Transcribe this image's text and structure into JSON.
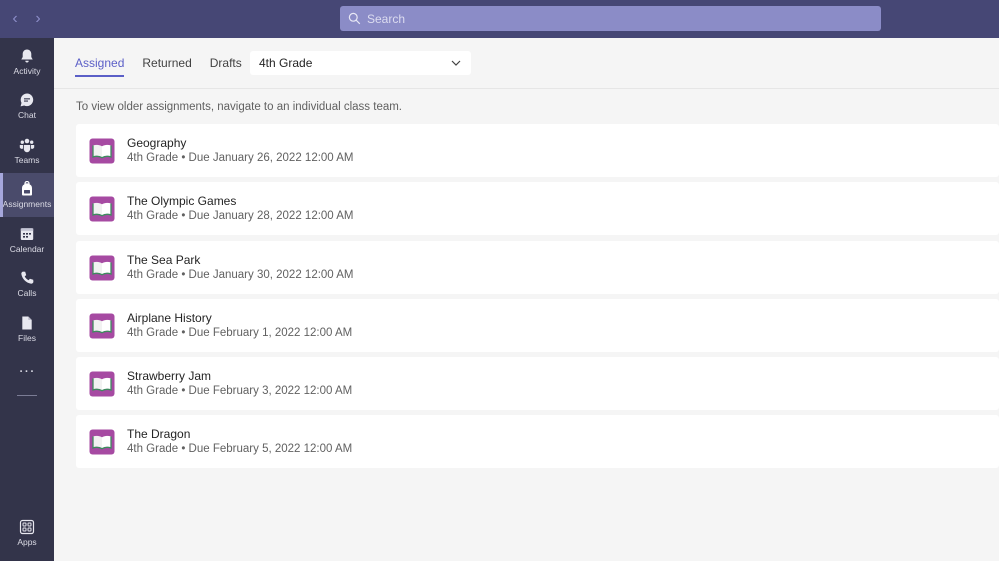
{
  "topbar": {
    "back_icon": "chevron-left-icon",
    "forward_icon": "chevron-right-icon",
    "search_placeholder": "Search",
    "colors": {
      "bar": "#464775",
      "search_bg": "#8b8cc7"
    }
  },
  "rail": {
    "items": [
      {
        "id": "activity",
        "label": "Activity",
        "icon": "bell-icon"
      },
      {
        "id": "chat",
        "label": "Chat",
        "icon": "chat-icon"
      },
      {
        "id": "teams",
        "label": "Teams",
        "icon": "teams-icon"
      },
      {
        "id": "assignments",
        "label": "Assignments",
        "icon": "backpack-icon",
        "active": true
      },
      {
        "id": "calendar",
        "label": "Calendar",
        "icon": "calendar-icon"
      },
      {
        "id": "calls",
        "label": "Calls",
        "icon": "phone-icon"
      },
      {
        "id": "files",
        "label": "Files",
        "icon": "file-icon"
      }
    ],
    "more": "...",
    "apps_label": "Apps"
  },
  "main": {
    "tabs": [
      {
        "label": "Assigned",
        "active": true
      },
      {
        "label": "Returned"
      },
      {
        "label": "Drafts"
      }
    ],
    "class_filter": "4th Grade",
    "hint": "To view older assignments, navigate to an individual class team.",
    "accent": "#5b5fc7",
    "assignments": [
      {
        "title": "Geography",
        "meta": "4th Grade • Due January 26, 2022 12:00 AM"
      },
      {
        "title": "The Olympic Games",
        "meta": "4th Grade • Due January 28, 2022 12:00 AM"
      },
      {
        "title": "The Sea Park",
        "meta": "4th Grade • Due January 30, 2022 12:00 AM"
      },
      {
        "title": "Airplane History",
        "meta": "4th Grade • Due February 1, 2022 12:00 AM"
      },
      {
        "title": "Strawberry Jam",
        "meta": "4th Grade • Due February 3, 2022 12:00 AM"
      },
      {
        "title": "The Dragon",
        "meta": "4th Grade • Due February 5, 2022 12:00 AM"
      }
    ]
  }
}
